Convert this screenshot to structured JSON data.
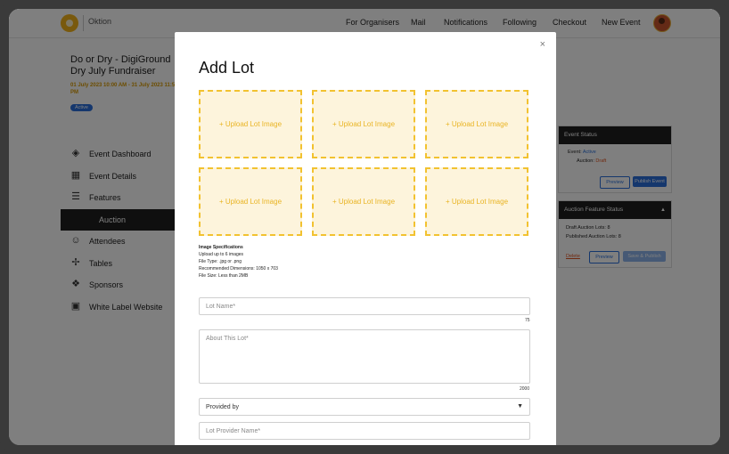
{
  "header": {
    "brand": "Oktion",
    "nav": [
      "For Organisers",
      "Mail",
      "Notifications",
      "Following",
      "Checkout",
      "New Event"
    ]
  },
  "event": {
    "title": "Do or Dry - DigiGround Dry July Fundraiser",
    "date": "01 July 2023 10:00 AM - 31 July 2023 11:59 PM",
    "status_badge": "Active"
  },
  "sidebar": {
    "items": [
      {
        "label": "Event Dashboard",
        "icon": "dashboard-icon"
      },
      {
        "label": "Event Details",
        "icon": "calendar-icon"
      },
      {
        "label": "Features",
        "icon": "sliders-icon"
      },
      {
        "label": "Auction",
        "icon": ""
      },
      {
        "label": "Attendees",
        "icon": "people-icon"
      },
      {
        "label": "Tables",
        "icon": "tables-icon"
      },
      {
        "label": "Sponsors",
        "icon": "sponsors-icon"
      },
      {
        "label": "White Label Website",
        "icon": "website-icon"
      }
    ]
  },
  "event_status_panel": {
    "title": "Event Status",
    "event_label": "Event:",
    "event_value": "Active",
    "auction_label": "Auction:",
    "auction_value": "Draft",
    "preview": "Preview",
    "publish": "Publish Event"
  },
  "auction_panel": {
    "title": "Auction Feature Status",
    "draft_lots": "Draft Auction Lots: 8",
    "published_lots": "Published Auction Lots: 8",
    "delete": "Delete",
    "preview": "Preview",
    "save_publish": "Save & Publish"
  },
  "modal": {
    "title": "Add Lot",
    "close": "×",
    "upload_label": "+ Upload Lot Image",
    "spec_title": "Image Specifications",
    "spec_lines": [
      "Upload up to 6 images",
      "File Type: .jpg or .png",
      "Recommended Dimensions: 1050 x 703",
      "File Size: Less than 2MB"
    ],
    "lot_name_placeholder": "Lot Name*",
    "lot_name_max": "75",
    "about_placeholder": "About This Lot*",
    "about_max": "2000",
    "provided_by": "Provided by",
    "provider_name_placeholder": "Lot Provider Name*"
  },
  "colors": {
    "accent": "#f2b31b",
    "primary": "#2a6fdb",
    "dark": "#1e1e1e"
  }
}
